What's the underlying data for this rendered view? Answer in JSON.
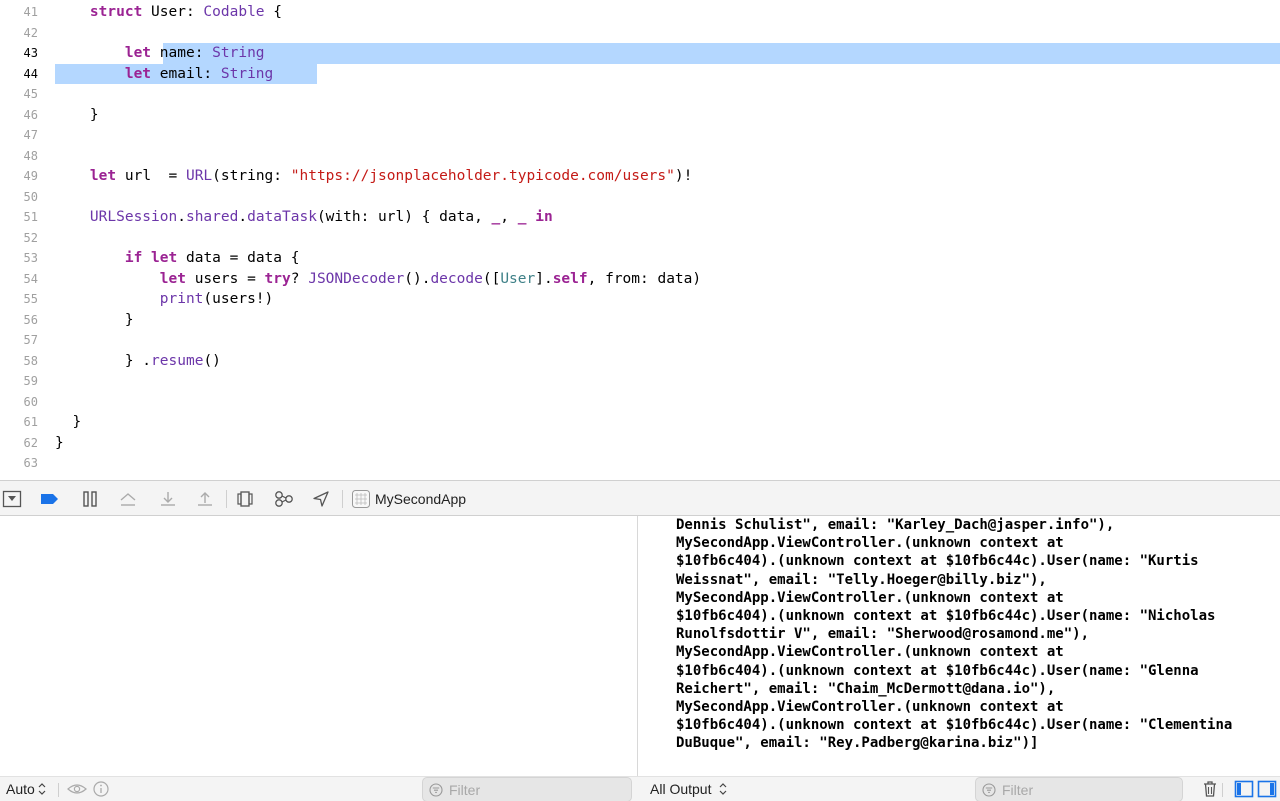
{
  "editor": {
    "lines": [
      {
        "n": "41",
        "indent": "    ",
        "tokens": [
          [
            "kw",
            "struct"
          ],
          [
            "p",
            " User: "
          ],
          [
            "ty",
            "Codable"
          ],
          [
            "p",
            " {"
          ]
        ]
      },
      {
        "n": "42",
        "indent": "",
        "tokens": []
      },
      {
        "n": "43",
        "indent": "        ",
        "active": true,
        "tokens": [
          [
            "kw",
            "let"
          ],
          [
            "p",
            " name: "
          ],
          [
            "ty",
            "String"
          ]
        ]
      },
      {
        "n": "44",
        "indent": "        ",
        "active": true,
        "tokens": [
          [
            "kw",
            "let"
          ],
          [
            "p",
            " email: "
          ],
          [
            "ty",
            "String"
          ]
        ]
      },
      {
        "n": "45",
        "indent": "",
        "tokens": []
      },
      {
        "n": "46",
        "indent": "    ",
        "tokens": [
          [
            "p",
            "}"
          ]
        ]
      },
      {
        "n": "47",
        "indent": "",
        "tokens": []
      },
      {
        "n": "48",
        "indent": "",
        "tokens": []
      },
      {
        "n": "49",
        "indent": "    ",
        "tokens": [
          [
            "kw",
            "let"
          ],
          [
            "p",
            " url  = "
          ],
          [
            "ty",
            "URL"
          ],
          [
            "p",
            "(string: "
          ],
          [
            "str",
            "\"https://jsonplaceholder.typicode.com/users\""
          ],
          [
            "p",
            ")!"
          ]
        ]
      },
      {
        "n": "50",
        "indent": "",
        "tokens": []
      },
      {
        "n": "51",
        "indent": "    ",
        "tokens": [
          [
            "ty",
            "URLSession"
          ],
          [
            "p",
            "."
          ],
          [
            "fn",
            "shared"
          ],
          [
            "p",
            "."
          ],
          [
            "fn",
            "dataTask"
          ],
          [
            "p",
            "(with: url) { data, "
          ],
          [
            "kw",
            "_"
          ],
          [
            "p",
            ", "
          ],
          [
            "kw",
            "_"
          ],
          [
            "p",
            " "
          ],
          [
            "kw",
            "in"
          ]
        ]
      },
      {
        "n": "52",
        "indent": "",
        "tokens": []
      },
      {
        "n": "53",
        "indent": "        ",
        "tokens": [
          [
            "kw",
            "if"
          ],
          [
            "p",
            " "
          ],
          [
            "kw",
            "let"
          ],
          [
            "p",
            " data = data {"
          ]
        ]
      },
      {
        "n": "54",
        "indent": "            ",
        "tokens": [
          [
            "kw",
            "let"
          ],
          [
            "p",
            " users = "
          ],
          [
            "kw",
            "try"
          ],
          [
            "p",
            "? "
          ],
          [
            "ty",
            "JSONDecoder"
          ],
          [
            "p",
            "()."
          ],
          [
            "fn",
            "decode"
          ],
          [
            "p",
            "(["
          ],
          [
            "ut",
            "User"
          ],
          [
            "p",
            "]."
          ],
          [
            "kw",
            "self"
          ],
          [
            "p",
            ", from: data)"
          ]
        ]
      },
      {
        "n": "55",
        "indent": "            ",
        "tokens": [
          [
            "fn",
            "print"
          ],
          [
            "p",
            "(users!)"
          ]
        ]
      },
      {
        "n": "56",
        "indent": "        ",
        "tokens": [
          [
            "p",
            "}"
          ]
        ]
      },
      {
        "n": "57",
        "indent": "",
        "tokens": []
      },
      {
        "n": "58",
        "indent": "        ",
        "tokens": [
          [
            "p",
            "} ."
          ],
          [
            "fn",
            "resume"
          ],
          [
            "p",
            "()"
          ]
        ]
      },
      {
        "n": "59",
        "indent": "",
        "tokens": []
      },
      {
        "n": "60",
        "indent": "",
        "tokens": []
      },
      {
        "n": "61",
        "indent": "  ",
        "tokens": [
          [
            "p",
            "}"
          ]
        ]
      },
      {
        "n": "62",
        "indent": "",
        "tokens": [
          [
            "p",
            "}"
          ]
        ]
      },
      {
        "n": "63",
        "indent": "",
        "tokens": []
      }
    ]
  },
  "debugbar": {
    "scheme": "MySecondApp",
    "icons": [
      "hide-debug-area-icon",
      "breakpoints-toggle-icon",
      "pause-icon",
      "step-over-icon",
      "step-into-icon",
      "step-out-icon",
      "view-hierarchy-icon",
      "memory-graph-icon",
      "simulate-location-icon",
      "scheme-app-icon"
    ]
  },
  "console": {
    "lines": [
      "Dennis Schulist\", email: \"Karley_Dach@jasper.info\"),",
      "MySecondApp.ViewController.(unknown context at",
      "$10fb6c404).(unknown context at $10fb6c44c).User(name: \"Kurtis",
      "Weissnat\", email: \"Telly.Hoeger@billy.biz\"),",
      "MySecondApp.ViewController.(unknown context at",
      "$10fb6c404).(unknown context at $10fb6c44c).User(name: \"Nicholas",
      "Runolfsdottir V\", email: \"Sherwood@rosamond.me\"),",
      "MySecondApp.ViewController.(unknown context at",
      "$10fb6c404).(unknown context at $10fb6c44c).User(name: \"Glenna",
      "Reichert\", email: \"Chaim_McDermott@dana.io\"),",
      "MySecondApp.ViewController.(unknown context at",
      "$10fb6c404).(unknown context at $10fb6c44c).User(name: \"Clementina",
      "DuBuque\", email: \"Rey.Padberg@karina.biz\")]"
    ]
  },
  "bottombar": {
    "variables_mode": "Auto",
    "variables_filter_placeholder": "Filter",
    "output_mode": "All Output",
    "console_filter_placeholder": "Filter"
  },
  "colors": {
    "keyword": "#9b2393",
    "type": "#6c36a9",
    "user_type": "#3e8087",
    "string": "#c41a16",
    "selection": "#b4d7ff",
    "accent": "#1a73e8"
  }
}
